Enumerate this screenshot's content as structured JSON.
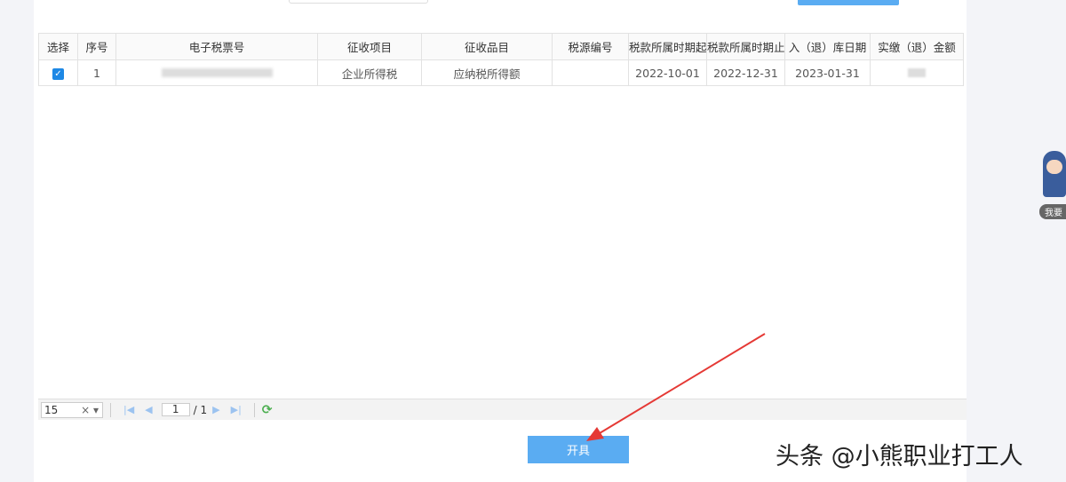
{
  "table": {
    "headers": [
      "选择",
      "序号",
      "电子税票号",
      "征收项目",
      "征收品目",
      "税源编号",
      "税款所属时期起",
      "税款所属时期止",
      "入（退）库日期",
      "实缴（退）金额"
    ],
    "rows": [
      {
        "checked": true,
        "index": "1",
        "ticket_no": "",
        "item": "企业所得税",
        "category": "应纳税所得额",
        "source_no": "",
        "period_start": "2022-10-01",
        "period_end": "2022-12-31",
        "storage_date": "2023-01-31",
        "amount": ""
      }
    ]
  },
  "pager": {
    "page_size": "15",
    "clear": "×",
    "dropdown": "▾",
    "current_page": "1",
    "total_pages": "/ 1"
  },
  "buttons": {
    "issue": "开具"
  },
  "mascot": {
    "label": "我要"
  },
  "watermark": "头条 @小熊职业打工人",
  "colors": {
    "accent": "#5aacf2",
    "arrow": "#e53935"
  }
}
